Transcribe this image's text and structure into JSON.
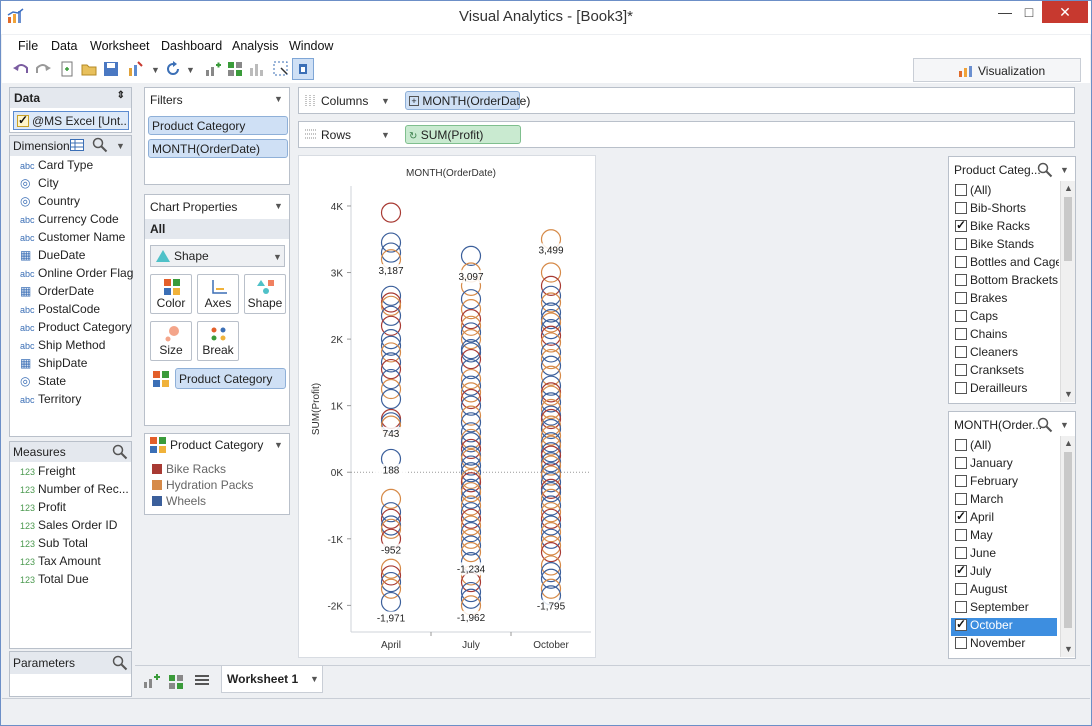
{
  "window": {
    "title": "Visual Analytics - [Book3]*",
    "minimize": "—",
    "maximize": "□",
    "close": "✕"
  },
  "menu": [
    "File",
    "Data",
    "Worksheet",
    "Dashboard",
    "Analysis",
    "Window"
  ],
  "visualization_tab": {
    "label": "Visualization"
  },
  "data_panel": {
    "title": "Data",
    "source": "@MS Excel [Unt...",
    "dimensions_title": "Dimensions",
    "dimensions": [
      {
        "type": "abc",
        "label": "Card Type"
      },
      {
        "type": "geo",
        "label": "City"
      },
      {
        "type": "geo",
        "label": "Country"
      },
      {
        "type": "abc",
        "label": "Currency Code"
      },
      {
        "type": "abc",
        "label": "Customer Name"
      },
      {
        "type": "date",
        "label": "DueDate"
      },
      {
        "type": "abc",
        "label": "Online Order Flag"
      },
      {
        "type": "date",
        "label": "OrderDate"
      },
      {
        "type": "abc",
        "label": "PostalCode"
      },
      {
        "type": "abc",
        "label": "Product Category"
      },
      {
        "type": "abc",
        "label": "Ship Method"
      },
      {
        "type": "date",
        "label": "ShipDate"
      },
      {
        "type": "geo",
        "label": "State"
      },
      {
        "type": "abc",
        "label": "Territory"
      }
    ],
    "measures_title": "Measures",
    "measures": [
      "Freight",
      "Number of Rec...",
      "Profit",
      "Sales Order ID",
      "Sub Total",
      "Tax Amount",
      "Total Due"
    ],
    "parameters_title": "Parameters"
  },
  "filters": {
    "title": "Filters",
    "items": [
      "Product Category",
      "MONTH(OrderDate)"
    ]
  },
  "chart_properties": {
    "title": "Chart Properties",
    "scope": "All",
    "mark_type": "Shape",
    "cards": [
      "Color",
      "Axes",
      "Shape",
      "Size",
      "Break"
    ],
    "color_field": "Product Category"
  },
  "legend": {
    "title": "Product Category",
    "items": [
      {
        "label": "Bike Racks",
        "color": "#a83a33"
      },
      {
        "label": "Hydration Packs",
        "color": "#d68a48"
      },
      {
        "label": "Wheels",
        "color": "#3b5f9b"
      }
    ]
  },
  "shelves": {
    "columns_label": "Columns",
    "columns_pill": "MONTH(OrderDate)",
    "rows_label": "Rows",
    "rows_pill": "SUM(Profit)"
  },
  "filter_card_1": {
    "title": "Product Categ...",
    "items": [
      {
        "label": "(All)",
        "checked": false
      },
      {
        "label": "Bib-Shorts",
        "checked": false
      },
      {
        "label": "Bike Racks",
        "checked": true
      },
      {
        "label": "Bike Stands",
        "checked": false
      },
      {
        "label": "Bottles and Cages",
        "checked": false
      },
      {
        "label": "Bottom Brackets",
        "checked": false
      },
      {
        "label": "Brakes",
        "checked": false
      },
      {
        "label": "Caps",
        "checked": false
      },
      {
        "label": "Chains",
        "checked": false
      },
      {
        "label": "Cleaners",
        "checked": false
      },
      {
        "label": "Cranksets",
        "checked": false
      },
      {
        "label": "Derailleurs",
        "checked": false
      }
    ]
  },
  "filter_card_2": {
    "title": "MONTH(Order...",
    "items": [
      {
        "label": "(All)",
        "checked": false
      },
      {
        "label": "January",
        "checked": false
      },
      {
        "label": "February",
        "checked": false
      },
      {
        "label": "March",
        "checked": false
      },
      {
        "label": "April",
        "checked": true
      },
      {
        "label": "May",
        "checked": false
      },
      {
        "label": "June",
        "checked": false
      },
      {
        "label": "July",
        "checked": true
      },
      {
        "label": "August",
        "checked": false
      },
      {
        "label": "September",
        "checked": false
      },
      {
        "label": "October",
        "checked": true,
        "selected": true
      },
      {
        "label": "November",
        "checked": false
      }
    ]
  },
  "worksheet_tab": {
    "label": "Worksheet 1"
  },
  "chart_data": {
    "type": "scatter",
    "title": "MONTH(OrderDate)",
    "ylabel": "SUM(Profit)",
    "ylim": [
      -2400,
      4300
    ],
    "y_ticks": [
      "4K",
      "3K",
      "2K",
      "1K",
      "0K",
      "-1K",
      "-2K"
    ],
    "categories": [
      "April",
      "July",
      "October"
    ],
    "series": [
      {
        "name": "Bike Racks",
        "color": "#a83a33"
      },
      {
        "name": "Hydration Packs",
        "color": "#d68a48"
      },
      {
        "name": "Wheels",
        "color": "#3b5f9b"
      }
    ],
    "data_labels": [
      {
        "category": "April",
        "value": 3187,
        "text": "3,187"
      },
      {
        "category": "April",
        "value": 743,
        "text": "743"
      },
      {
        "category": "April",
        "value": 188,
        "text": "188"
      },
      {
        "category": "April",
        "value": -952,
        "text": "-952"
      },
      {
        "category": "April",
        "value": -1971,
        "text": "-1,971"
      },
      {
        "category": "July",
        "value": 3097,
        "text": "3,097"
      },
      {
        "category": "July",
        "value": -1234,
        "text": "-1,234"
      },
      {
        "category": "July",
        "value": -1962,
        "text": "-1,962"
      },
      {
        "category": "October",
        "value": 3499,
        "text": "3,499"
      },
      {
        "category": "October",
        "value": -1795,
        "text": "-1,795"
      }
    ],
    "points": {
      "April": [
        [
          3900,
          0
        ],
        [
          3450,
          2
        ],
        [
          3300,
          2
        ],
        [
          3200,
          1
        ],
        [
          2650,
          2
        ],
        [
          2550,
          0
        ],
        [
          2500,
          1
        ],
        [
          2350,
          2
        ],
        [
          2200,
          0
        ],
        [
          2000,
          2
        ],
        [
          1900,
          2
        ],
        [
          1800,
          1
        ],
        [
          1650,
          2
        ],
        [
          1550,
          0
        ],
        [
          1400,
          2
        ],
        [
          1250,
          1
        ],
        [
          1100,
          2
        ],
        [
          800,
          0
        ],
        [
          750,
          2
        ],
        [
          700,
          1
        ],
        [
          200,
          2
        ],
        [
          -400,
          1
        ],
        [
          -600,
          2
        ],
        [
          -700,
          0
        ],
        [
          -800,
          2
        ],
        [
          -850,
          1
        ],
        [
          -1000,
          0
        ],
        [
          -1450,
          1
        ],
        [
          -1550,
          0
        ],
        [
          -1650,
          2
        ],
        [
          -1750,
          1
        ],
        [
          -1950,
          2
        ]
      ],
      "July": [
        [
          3250,
          2
        ],
        [
          3000,
          1
        ],
        [
          2800,
          1
        ],
        [
          2600,
          2
        ],
        [
          2450,
          1
        ],
        [
          2300,
          0
        ],
        [
          2200,
          1
        ],
        [
          2100,
          2
        ],
        [
          2000,
          1
        ],
        [
          1850,
          2
        ],
        [
          1800,
          2
        ],
        [
          1700,
          0
        ],
        [
          1550,
          2
        ],
        [
          1400,
          1
        ],
        [
          1300,
          2
        ],
        [
          1200,
          1
        ],
        [
          1100,
          0
        ],
        [
          1000,
          2
        ],
        [
          850,
          1
        ],
        [
          750,
          2
        ],
        [
          600,
          2
        ],
        [
          500,
          1
        ],
        [
          450,
          2
        ],
        [
          350,
          0
        ],
        [
          250,
          2
        ],
        [
          200,
          1
        ],
        [
          100,
          2
        ],
        [
          0,
          2
        ],
        [
          -100,
          1
        ],
        [
          -150,
          0
        ],
        [
          -250,
          2
        ],
        [
          -300,
          1
        ],
        [
          -400,
          2
        ],
        [
          -500,
          1
        ],
        [
          -600,
          2
        ],
        [
          -700,
          0
        ],
        [
          -800,
          1
        ],
        [
          -900,
          2
        ],
        [
          -1000,
          1
        ],
        [
          -1100,
          2
        ],
        [
          -1200,
          1
        ],
        [
          -1350,
          2
        ],
        [
          -1550,
          1
        ],
        [
          -1650,
          0
        ],
        [
          -1800,
          2
        ],
        [
          -1900,
          2
        ],
        [
          -2000,
          1
        ]
      ],
      "October": [
        [
          3500,
          1
        ],
        [
          3000,
          1
        ],
        [
          2800,
          0
        ],
        [
          2650,
          2
        ],
        [
          2550,
          1
        ],
        [
          2400,
          2
        ],
        [
          2300,
          2
        ],
        [
          2250,
          1
        ],
        [
          2150,
          2
        ],
        [
          2050,
          0
        ],
        [
          1950,
          1
        ],
        [
          1800,
          2
        ],
        [
          1700,
          1
        ],
        [
          1600,
          2
        ],
        [
          1450,
          1
        ],
        [
          1300,
          2
        ],
        [
          1200,
          0
        ],
        [
          1150,
          1
        ],
        [
          1050,
          2
        ],
        [
          950,
          1
        ],
        [
          850,
          2
        ],
        [
          800,
          0
        ],
        [
          700,
          1
        ],
        [
          650,
          2
        ],
        [
          550,
          1
        ],
        [
          450,
          2
        ],
        [
          400,
          1
        ],
        [
          300,
          2
        ],
        [
          250,
          0
        ],
        [
          150,
          2
        ],
        [
          100,
          1
        ],
        [
          0,
          2
        ],
        [
          -50,
          1
        ],
        [
          -150,
          2
        ],
        [
          -250,
          0
        ],
        [
          -300,
          2
        ],
        [
          -400,
          1
        ],
        [
          -500,
          2
        ],
        [
          -600,
          1
        ],
        [
          -700,
          0
        ],
        [
          -800,
          2
        ],
        [
          -900,
          1
        ],
        [
          -1000,
          2
        ],
        [
          -1100,
          1
        ],
        [
          -1200,
          0
        ],
        [
          -1400,
          1
        ],
        [
          -1500,
          2
        ],
        [
          -1600,
          2
        ],
        [
          -1750,
          1
        ],
        [
          -1850,
          2
        ]
      ]
    }
  }
}
